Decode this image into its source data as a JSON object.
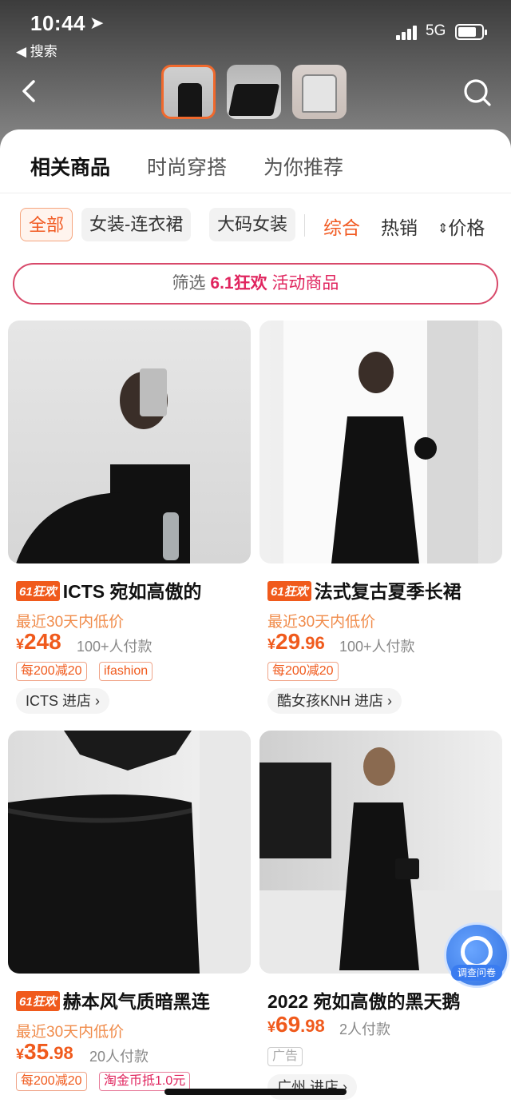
{
  "status_bar": {
    "time": "10:44",
    "network": "5G",
    "back_app": "◀ 搜索"
  },
  "tabs": [
    "相关商品",
    "时尚穿搭",
    "为你推荐"
  ],
  "filters": {
    "chips": [
      "全部",
      "女装-连衣裙",
      "大码女装"
    ],
    "sorts": [
      "综合",
      "热销",
      "价格"
    ]
  },
  "promo": {
    "prefix": "筛选",
    "highlight": "6.1狂欢",
    "suffix": "活动商品"
  },
  "badge": "61狂欢",
  "products": [
    {
      "title": "ICTS 宛如高傲的",
      "has_badge": true,
      "low_price_note": "最近30天内低价",
      "price_int": "248",
      "price_dec": "",
      "sold": "100+人付款",
      "tags": [
        "每200减20",
        "ifashion"
      ],
      "store": "ICTS 进店 ›"
    },
    {
      "title": "法式复古夏季长裙",
      "has_badge": true,
      "low_price_note": "最近30天内低价",
      "price_int": "29",
      "price_dec": ".96",
      "sold": "100+人付款",
      "tags": [
        "每200减20"
      ],
      "store": "酷女孩KNH 进店 ›"
    },
    {
      "title": "赫本风气质暗黑连",
      "has_badge": true,
      "low_price_note": "最近30天内低价",
      "price_int": "35",
      "price_dec": ".98",
      "sold": "20人付款",
      "tags": [
        "每200减20",
        "淘金币抵1.0元"
      ],
      "store": ""
    },
    {
      "title": "2022 宛如高傲的黑天鹅",
      "has_badge": false,
      "low_price_note": "",
      "price_int": "69",
      "price_dec": ".98",
      "sold": "2人付款",
      "tags": [
        "广告"
      ],
      "store": "广州 进店 ›"
    }
  ],
  "currency": "¥",
  "survey_label": "调查问卷"
}
